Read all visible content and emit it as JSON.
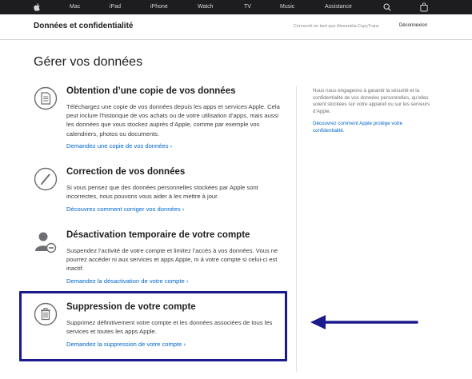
{
  "nav": {
    "items": [
      "Mac",
      "iPad",
      "iPhone",
      "Watch",
      "TV",
      "Music",
      "Assistance"
    ],
    "icons": [
      "apple-icon",
      "search-icon",
      "bag-icon"
    ]
  },
  "local_nav": {
    "title": "Données et confidentialité",
    "connected": "Connecté en tant que Alexandra CopyTrans",
    "logout": "Déconnexion"
  },
  "main": {
    "heading": "Gérer vos données",
    "sections": [
      {
        "icon": "document-icon",
        "title": "Obtention d’une copie de vos données",
        "body": "Téléchargez une copie de vos données depuis les apps et services Apple. Cela peut inclure l’historique de vos achats ou de votre utilisation d’apps, mais aussi les données que vous stockez auprès d’Apple, comme par exemple vos calendriers, photos ou documents.",
        "link": "Demandez une copie de vos données ›"
      },
      {
        "icon": "pencil-icon",
        "title": "Correction de vos données",
        "body": "Si vous pensez que des données personnelles stockées par Apple sont incorrectes, nous pouvons vous aider à les mettre à jour.",
        "link": "Découvrez comment corriger vos données ›"
      },
      {
        "icon": "person-icon",
        "title": "Désactivation temporaire de votre compte",
        "body": "Suspendez l’activité de votre compte et limitez l’accès à vos données. Vous ne pourrez accéder ni aux services et apps Apple, ni à votre compte si celui-ci est inactif.",
        "link": "Demandez la désactivation de votre compte ›"
      },
      {
        "icon": "trash-icon",
        "title": "Suppression de votre compte",
        "body": "Supprimez définitivement votre compte et les données associées de tous les services et toutes les apps Apple.",
        "link": "Demandez la suppression de votre compte ›"
      }
    ]
  },
  "sidebar": {
    "text": "Nous nous engageons à garantir la sécurité et la confidentialité de vos données personnelles, qu’elles soient stockées sur votre appareil ou sur les serveurs d’Apple.",
    "link": "Découvrez comment Apple protège votre confidentialité."
  },
  "colors": {
    "nav_bg": "#1d1d1f",
    "link": "#0066cc",
    "highlight": "#1a1a8c"
  }
}
